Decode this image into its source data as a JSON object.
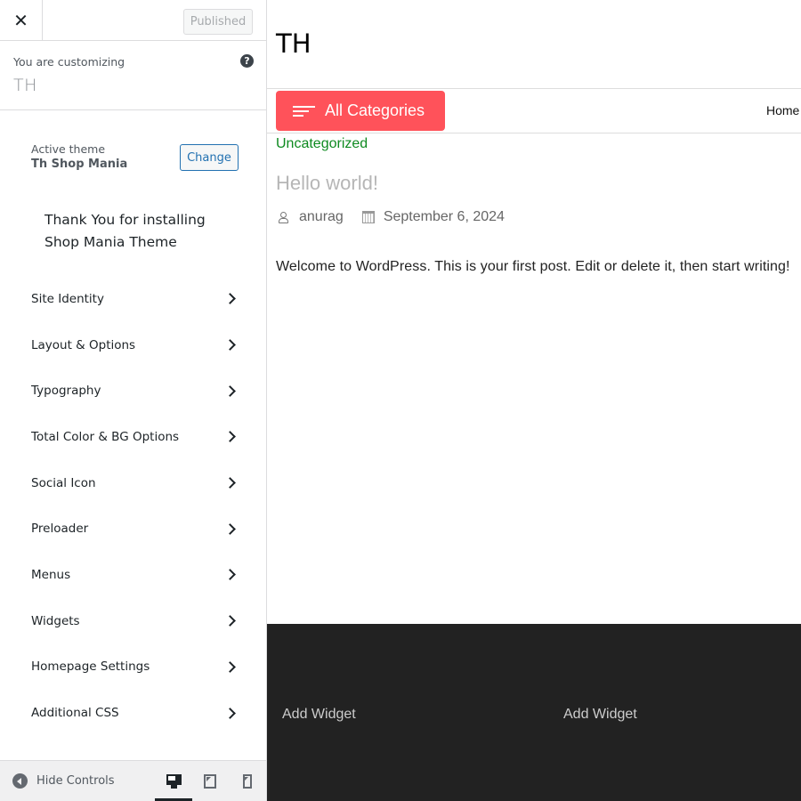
{
  "header": {
    "close_icon": "close-icon",
    "publish_button": "Published"
  },
  "info": {
    "label": "You are customizing",
    "site_name": "TH",
    "help_icon": "?"
  },
  "theme": {
    "label": "Active theme",
    "name": "Th Shop Mania",
    "change_button": "Change"
  },
  "notice": {
    "line1": "Thank You for installing",
    "line2": "Shop Mania Theme"
  },
  "sections": [
    {
      "label": "Site Identity"
    },
    {
      "label": "Layout & Options"
    },
    {
      "label": "Typography"
    },
    {
      "label": "Total Color & BG Options"
    },
    {
      "label": "Social Icon"
    },
    {
      "label": "Preloader"
    },
    {
      "label": "Menus"
    },
    {
      "label": "Widgets"
    },
    {
      "label": "Homepage Settings"
    },
    {
      "label": "Additional CSS"
    }
  ],
  "footer": {
    "hide_controls": "Hide Controls",
    "devices": [
      "desktop",
      "tablet",
      "mobile"
    ],
    "active_device": "desktop"
  },
  "preview": {
    "site_title": "TH",
    "categories_button": "All Categories",
    "nav_home": "Home",
    "category": "Uncategorized",
    "post_title": "Hello world!",
    "author": "anurag",
    "date": "September 6, 2024",
    "excerpt": "Welcome to WordPress. This is your first post. Edit or delete it, then start writing!",
    "widgets": [
      "Add Widget",
      "Add Widget"
    ],
    "colors": {
      "accent": "#ff525a",
      "category": "#0e8a20",
      "footer_bg": "#222222"
    }
  }
}
